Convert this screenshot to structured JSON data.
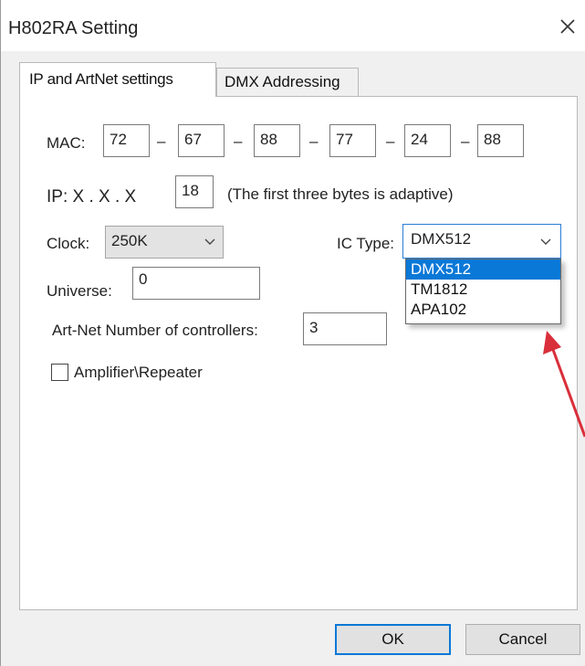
{
  "window": {
    "title": "H802RA Setting",
    "close_icon": "close-icon"
  },
  "tabs": [
    {
      "label": "IP and ArtNet settings",
      "active": true
    },
    {
      "label": "DMX Addressing",
      "active": false
    }
  ],
  "mac": {
    "label": "MAC:",
    "separator": "–",
    "values": [
      "72",
      "67",
      "88",
      "77",
      "24",
      "88"
    ]
  },
  "ip": {
    "label": "IP: X . X . X",
    "value": "18",
    "note": "(The first three bytes  is adaptive)"
  },
  "clock": {
    "label": "Clock:",
    "value": "250K"
  },
  "ic_type": {
    "label": "IC Type:",
    "value": "DMX512",
    "options": [
      "DMX512",
      "TM1812",
      "APA102"
    ],
    "highlighted": "DMX512"
  },
  "universe": {
    "label": "Universe:",
    "value": "0"
  },
  "artnet": {
    "label": "Art-Net Number of controllers:",
    "value": "3"
  },
  "amplifier": {
    "label": "Amplifier\\Repeater",
    "checked": false
  },
  "buttons": {
    "ok": "OK",
    "cancel": "Cancel"
  },
  "annotation": {
    "arrow_color": "#d92f3a"
  }
}
